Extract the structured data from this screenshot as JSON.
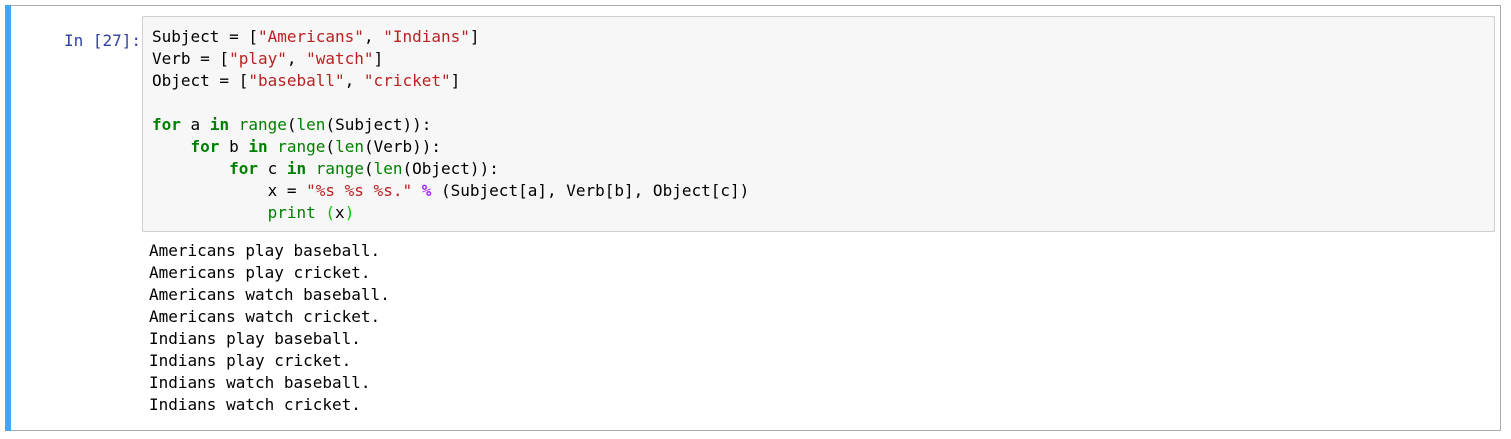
{
  "cell": {
    "prompt": "In [27]:",
    "code_lines": [
      {
        "tokens": [
          {
            "t": "Subject = [",
            "c": ""
          },
          {
            "t": "\"Americans\"",
            "c": "st"
          },
          {
            "t": ", ",
            "c": ""
          },
          {
            "t": "\"Indians\"",
            "c": "st"
          },
          {
            "t": "]",
            "c": ""
          }
        ]
      },
      {
        "tokens": [
          {
            "t": "Verb = [",
            "c": ""
          },
          {
            "t": "\"play\"",
            "c": "st"
          },
          {
            "t": ", ",
            "c": ""
          },
          {
            "t": "\"watch\"",
            "c": "st"
          },
          {
            "t": "]",
            "c": ""
          }
        ]
      },
      {
        "tokens": [
          {
            "t": "Object = [",
            "c": ""
          },
          {
            "t": "\"baseball\"",
            "c": "st"
          },
          {
            "t": ", ",
            "c": ""
          },
          {
            "t": "\"cricket\"",
            "c": "st"
          },
          {
            "t": "]",
            "c": ""
          }
        ]
      },
      {
        "tokens": [
          {
            "t": "",
            "c": ""
          }
        ]
      },
      {
        "tokens": [
          {
            "t": "for",
            "c": "kw"
          },
          {
            "t": " a ",
            "c": ""
          },
          {
            "t": "in",
            "c": "kw"
          },
          {
            "t": " ",
            "c": ""
          },
          {
            "t": "range",
            "c": "bi"
          },
          {
            "t": "(",
            "c": ""
          },
          {
            "t": "len",
            "c": "bi"
          },
          {
            "t": "(Subject)):",
            "c": ""
          }
        ]
      },
      {
        "tokens": [
          {
            "t": "    ",
            "c": ""
          },
          {
            "t": "for",
            "c": "kw"
          },
          {
            "t": " b ",
            "c": ""
          },
          {
            "t": "in",
            "c": "kw"
          },
          {
            "t": " ",
            "c": ""
          },
          {
            "t": "range",
            "c": "bi"
          },
          {
            "t": "(",
            "c": ""
          },
          {
            "t": "len",
            "c": "bi"
          },
          {
            "t": "(Verb)):",
            "c": ""
          }
        ]
      },
      {
        "tokens": [
          {
            "t": "        ",
            "c": ""
          },
          {
            "t": "for",
            "c": "kw"
          },
          {
            "t": " c ",
            "c": ""
          },
          {
            "t": "in",
            "c": "kw"
          },
          {
            "t": " ",
            "c": ""
          },
          {
            "t": "range",
            "c": "bi"
          },
          {
            "t": "(",
            "c": ""
          },
          {
            "t": "len",
            "c": "bi"
          },
          {
            "t": "(Object)):",
            "c": ""
          }
        ]
      },
      {
        "tokens": [
          {
            "t": "            x = ",
            "c": ""
          },
          {
            "t": "\"%s %s %s.\"",
            "c": "st"
          },
          {
            "t": " ",
            "c": ""
          },
          {
            "t": "%",
            "c": "op"
          },
          {
            "t": " (Subject[a], Verb[b], Object[c])",
            "c": ""
          }
        ]
      },
      {
        "tokens": [
          {
            "t": "            ",
            "c": ""
          },
          {
            "t": "print",
            "c": "bi"
          },
          {
            "t": " ",
            "c": ""
          },
          {
            "t": "(",
            "c": "par"
          },
          {
            "t": "x",
            "c": ""
          },
          {
            "t": ")",
            "c": "par"
          }
        ]
      }
    ],
    "output_lines": [
      "Americans play baseball.",
      "Americans play cricket.",
      "Americans watch baseball.",
      "Americans watch cricket.",
      "Indians play baseball.",
      "Indians play cricket.",
      "Indians watch baseball.",
      "Indians watch cricket."
    ],
    "colors": {
      "selected_bar": "#42a5f5",
      "prompt": "#303f9f",
      "keyword": "#008000",
      "string": "#ba2121",
      "operator": "#aa22ff"
    }
  }
}
